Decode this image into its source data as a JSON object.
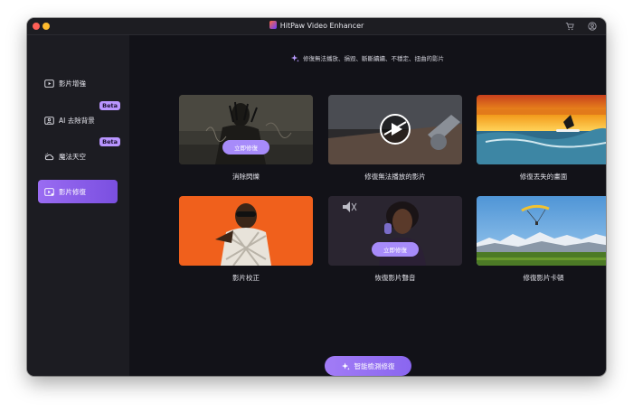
{
  "window": {
    "title": "HitPaw Video Enhancer"
  },
  "sidebar": {
    "items": [
      {
        "label": "影片增強",
        "icon": "video-enhance-icon",
        "badge": "",
        "active": false
      },
      {
        "label": "AI 去除背景",
        "icon": "ai-portrait-icon",
        "badge": "Beta",
        "active": false
      },
      {
        "label": "魔法天空",
        "icon": "cloud-sky-icon",
        "badge": "Beta",
        "active": false
      },
      {
        "label": "影片修復",
        "icon": "video-repair-icon",
        "badge": "",
        "active": true
      }
    ]
  },
  "main": {
    "subtitle": "修復無法播放、損毀、斷斷續續、不穩定、扭曲的影片",
    "cards": [
      {
        "label": "消除閃爍",
        "overlay_button": "立即修復"
      },
      {
        "label": "修復無法播放的影片",
        "overlay_button": ""
      },
      {
        "label": "修復丟失的畫面",
        "overlay_button": ""
      },
      {
        "label": "影片校正",
        "overlay_button": ""
      },
      {
        "label": "恢復影片聲音",
        "overlay_button": "立即修復"
      },
      {
        "label": "修復影片卡頓",
        "overlay_button": ""
      }
    ],
    "detect_button": "智能檢測修復"
  },
  "icons": {
    "titlebar": [
      "cart-icon",
      "account-icon"
    ],
    "subtitle": "sparkle-icon",
    "detect_button": "sparkle-icon"
  },
  "colors": {
    "accent": "#8a66ef",
    "beta_badge": "#b995ff",
    "background": "#121218",
    "sidebar": "#1c1c22"
  }
}
